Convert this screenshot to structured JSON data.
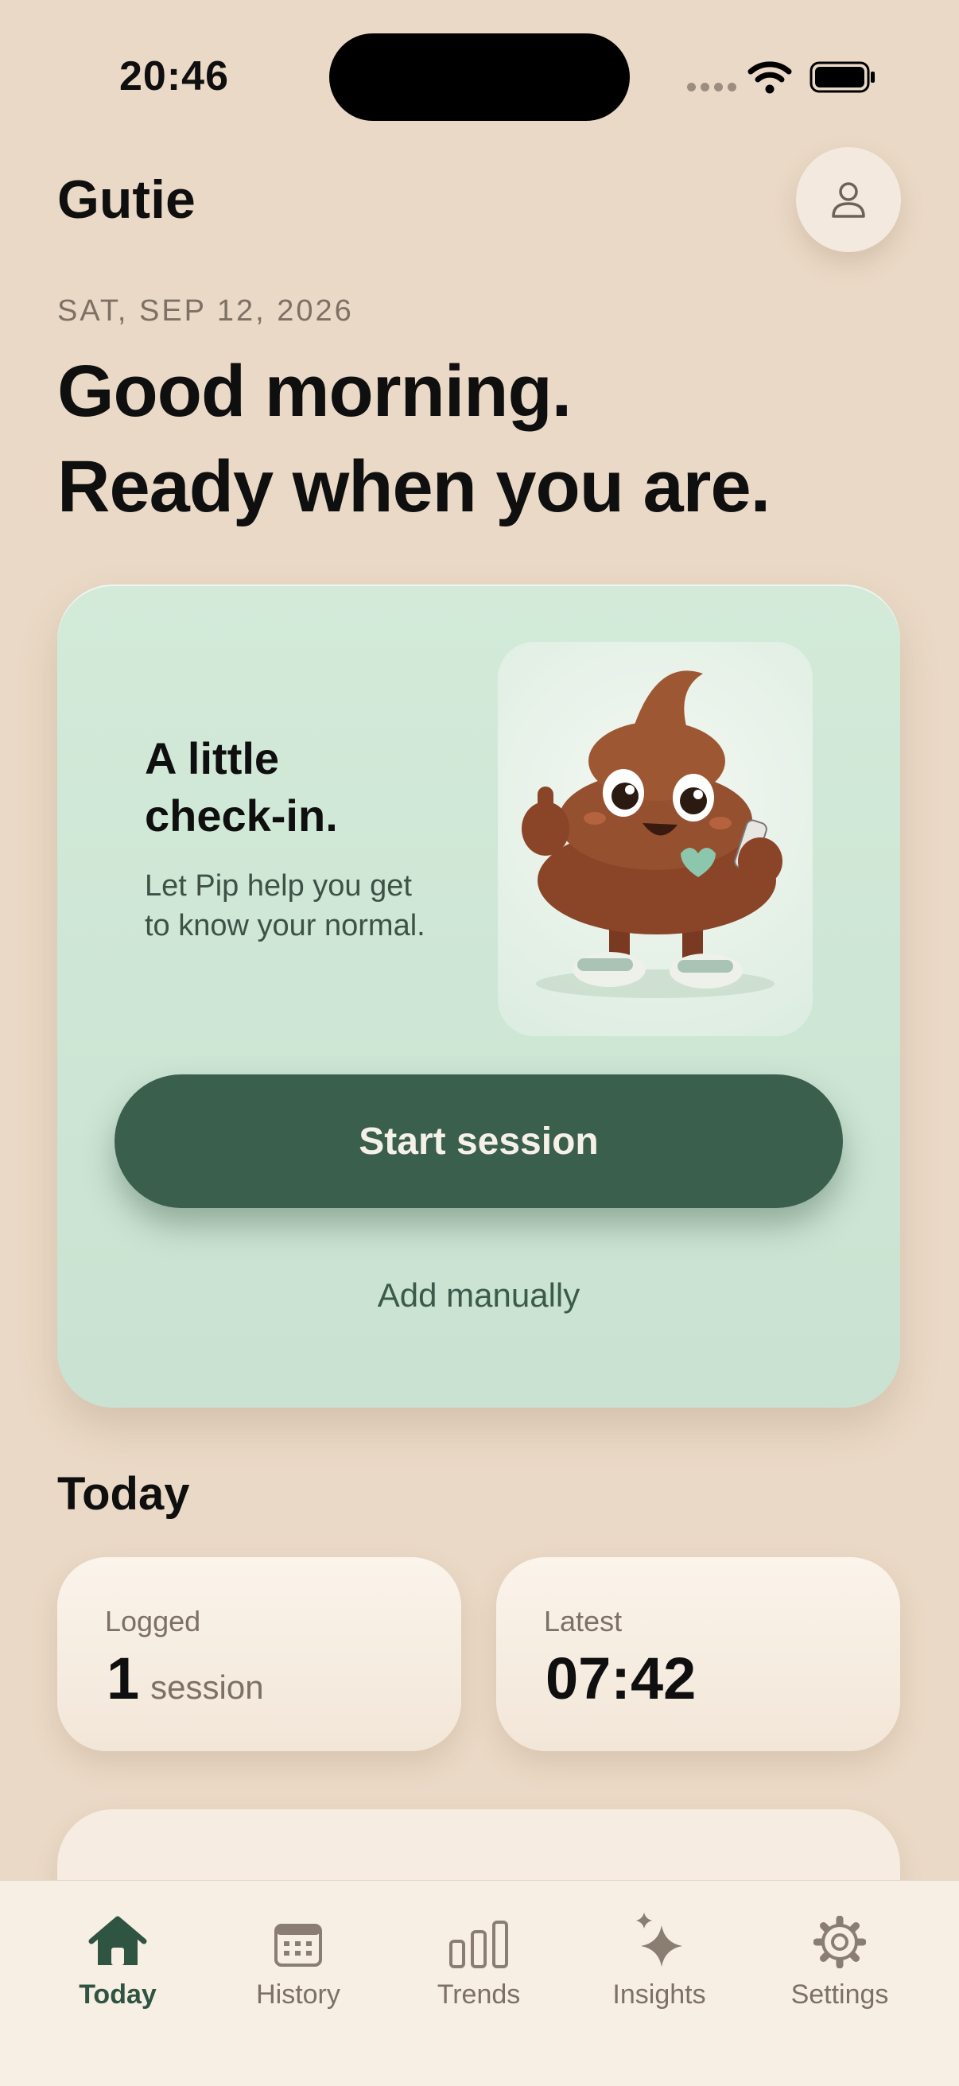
{
  "status_bar": {
    "time": "20:46"
  },
  "header": {
    "app_name": "Gutie",
    "profile_icon": "person-icon"
  },
  "date_line": "SAT, SEP 12, 2026",
  "greeting": {
    "line1": "Good morning.",
    "line2": "Ready when you are."
  },
  "checkin_card": {
    "title_line1": "A little",
    "title_line2": "check-in.",
    "subtitle_line1": "Let Pip help you get",
    "subtitle_line2": "to know your normal.",
    "primary_button": "Start session",
    "secondary_link": "Add manually"
  },
  "today": {
    "heading": "Today",
    "logged": {
      "label": "Logged",
      "value": "1",
      "unit": "session"
    },
    "latest": {
      "label": "Latest",
      "value": "07:42"
    }
  },
  "tabs": [
    {
      "label": "Today",
      "icon": "home-icon",
      "active": true
    },
    {
      "label": "History",
      "icon": "calendar-icon",
      "active": false
    },
    {
      "label": "Trends",
      "icon": "bar-chart-icon",
      "active": false
    },
    {
      "label": "Insights",
      "icon": "sparkle-icon",
      "active": false
    },
    {
      "label": "Settings",
      "icon": "gear-icon",
      "active": false
    }
  ],
  "colors": {
    "background": "#ead9c6",
    "accent": "#3a5f4c",
    "card_mint": "#cfe6d6"
  }
}
